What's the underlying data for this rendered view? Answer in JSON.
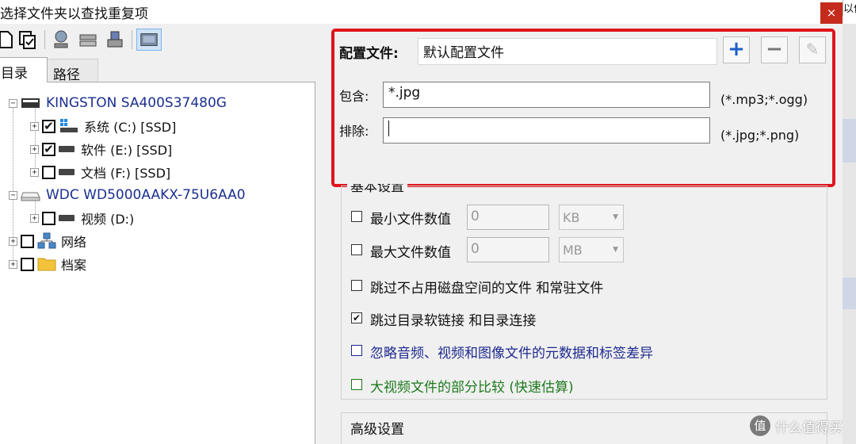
{
  "window": {
    "title": "选择文件夹以查找重复项",
    "close_glyph": "×",
    "sliver_text": "以件"
  },
  "tabs": [
    {
      "label": "目录"
    },
    {
      "label": "路径"
    }
  ],
  "tree": {
    "disks": [
      {
        "label": "KINGSTON SA400S37480G",
        "drives": [
          {
            "label": "系统 (C:) [SSD]",
            "checked": true,
            "check_glyph": "✔"
          },
          {
            "label": "软件 (E:) [SSD]",
            "checked": true,
            "check_glyph": "✔"
          },
          {
            "label": "文档 (F:) [SSD]",
            "checked": false,
            "check_glyph": ""
          }
        ]
      },
      {
        "label": "WDC WD5000AAKX-75U6AA0",
        "drives": [
          {
            "label": "视频 (D:)",
            "checked": false,
            "check_glyph": ""
          }
        ]
      }
    ],
    "network": {
      "label": "网络"
    },
    "archive": {
      "label": "档案"
    },
    "expander_glyph": "+"
  },
  "config": {
    "profile_label": "配置文件:",
    "profile_value": "默认配置文件",
    "include_label": "包含:",
    "include_value": "*.jpg",
    "include_hint": "(*.mp3;*.ogg)",
    "exclude_label": "排除:",
    "exclude_value": "",
    "exclude_hint": "(*.jpg;*.png)",
    "add_glyph": "+",
    "remove_glyph": "−",
    "edit_glyph": "✎"
  },
  "basic": {
    "title": "基本设置",
    "min_label": "最小文件数值",
    "min_value": "0",
    "min_unit": "KB",
    "max_label": "最大文件数值",
    "max_value": "0",
    "max_unit": "MB",
    "dropdown_glyph": "▼",
    "options": [
      {
        "label": "跳过不占用磁盘空间的文件 和常驻文件",
        "checked": false,
        "check_glyph": "",
        "color": "#111111"
      },
      {
        "label": "跳过目录软链接 和目录连接",
        "checked": true,
        "check_glyph": "✔",
        "color": "#111111"
      },
      {
        "label": "忽略音频、视频和图像文件的元数据和标签差异",
        "checked": false,
        "check_glyph": "",
        "color": "#1d2a8f"
      },
      {
        "label": "大视频文件的部分比较 (快速估算)",
        "checked": false,
        "check_glyph": "",
        "color": "#1d7a1d"
      }
    ]
  },
  "advanced": {
    "title": "高级设置"
  },
  "watermark": {
    "circle_text": "值",
    "text": "什么值得买"
  },
  "colors": {
    "highlight_border": "#e0141e",
    "add_button": "#1d5fc7",
    "disk_label": "#1a2f8f"
  }
}
